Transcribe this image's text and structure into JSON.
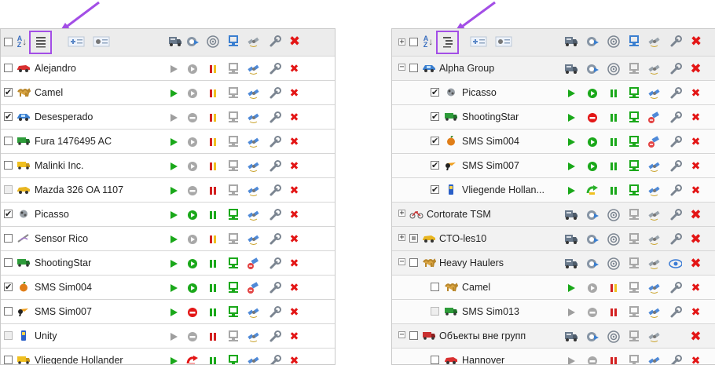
{
  "colors": {
    "arrow": "#a34ee6",
    "delete_red": "#e31616",
    "play_green": "#1aa81a",
    "stop_red": "#e31616",
    "highlight": "#a34ee6"
  },
  "left": {
    "header": {
      "sort_label": "A↓Z",
      "select_all_checked": false
    },
    "rows": [
      {
        "name": "Alejandro",
        "checked": false,
        "disabled": false,
        "icon": "car-red-icon",
        "play": "gray",
        "status": "gray-circle",
        "signal": "red-yellow",
        "active": false
      },
      {
        "name": "Camel",
        "checked": true,
        "disabled": false,
        "icon": "camel-icon",
        "play": "green",
        "status": "gray-circle",
        "signal": "red-yellow",
        "active": false
      },
      {
        "name": "Desesperado",
        "checked": true,
        "disabled": false,
        "icon": "car-blue-icon",
        "play": "gray",
        "status": "gray-dash",
        "signal": "red-yellow",
        "active": false
      },
      {
        "name": "Fura 1476495 AC",
        "checked": false,
        "disabled": false,
        "icon": "truck-green-icon",
        "play": "green",
        "status": "gray-circle",
        "signal": "red-yellow",
        "active": false
      },
      {
        "name": "Malinki Inc.",
        "checked": false,
        "disabled": false,
        "icon": "truck-yellow-icon",
        "play": "green",
        "status": "gray-circle",
        "signal": "red-yellow",
        "active": false
      },
      {
        "name": "Mazda 326 OA 1107",
        "checked": false,
        "disabled": true,
        "icon": "car-yellow-icon",
        "play": "green",
        "status": "gray-dash",
        "signal": "red-red",
        "active": false
      },
      {
        "name": "Picasso",
        "checked": true,
        "disabled": false,
        "icon": "picasso-icon",
        "play": "green",
        "status": "green-circle",
        "signal": "green",
        "active": true
      },
      {
        "name": "Sensor Rico",
        "checked": false,
        "disabled": false,
        "icon": "sensor-icon",
        "play": "green",
        "status": "gray-circle",
        "signal": "red-yellow",
        "active": false
      },
      {
        "name": "ShootingStar",
        "checked": false,
        "disabled": false,
        "icon": "truck-green-icon",
        "play": "green",
        "status": "green-circle",
        "signal": "green",
        "active": true
      },
      {
        "name": "SMS Sim004",
        "checked": true,
        "disabled": false,
        "icon": "apple-icon",
        "play": "green",
        "status": "green-circle",
        "signal": "green",
        "active": true
      },
      {
        "name": "SMS Sim007",
        "checked": false,
        "disabled": false,
        "icon": "toucan-icon",
        "play": "green",
        "status": "red-stop",
        "signal": "green",
        "active": true
      },
      {
        "name": "Unity",
        "checked": false,
        "disabled": true,
        "icon": "phone-icon",
        "play": "gray",
        "status": "gray-dash",
        "signal": "red-red",
        "active": false
      },
      {
        "name": "Vliegende Hollander",
        "checked": false,
        "disabled": false,
        "icon": "truck-yellow-icon",
        "play": "green",
        "status": "red-arrow",
        "signal": "green",
        "active": true
      }
    ]
  },
  "right": {
    "header": {
      "sort_label": "A↓Z"
    },
    "rows": [
      {
        "kind": "group",
        "name": "Alpha Group",
        "expander": "−",
        "checked": false,
        "icon": "car-blue-icon",
        "delete_big": true
      },
      {
        "kind": "child",
        "name": "Picasso",
        "checked": true,
        "icon": "picasso-icon",
        "status": "green-circle",
        "play": "green",
        "signal": "green",
        "active": true
      },
      {
        "kind": "child",
        "name": "ShootingStar",
        "checked": true,
        "icon": "truck-green-icon",
        "status": "red-stop",
        "play": "green",
        "signal": "green",
        "active": true
      },
      {
        "kind": "child",
        "name": "SMS Sim004",
        "checked": true,
        "icon": "apple-icon",
        "status": "green-circle",
        "play": "green",
        "signal": "green",
        "active": true
      },
      {
        "kind": "child",
        "name": "SMS Sim007",
        "checked": true,
        "icon": "toucan-icon",
        "status": "green-circle",
        "play": "green",
        "signal": "green",
        "active": true
      },
      {
        "kind": "child",
        "name": "Vliegende Hollan...",
        "checked": true,
        "icon": "phone-icon",
        "status": "green-arrow",
        "play": "green",
        "signal": "green",
        "active": true
      },
      {
        "kind": "group",
        "name": "Cortorate TSM",
        "expander": "+",
        "checked": null,
        "icon": "bike-icon",
        "delete_big": true
      },
      {
        "kind": "group",
        "name": "CTO-les10",
        "expander": "+",
        "checked": "partial",
        "icon": "car-yellow-icon",
        "delete_big": true
      },
      {
        "kind": "group",
        "name": "Heavy Haulers",
        "expander": "−",
        "checked": false,
        "icon": "camel-icon",
        "delete_big": true,
        "eye": true
      },
      {
        "kind": "child",
        "name": "Camel",
        "checked": false,
        "icon": "camel-icon",
        "status": "gray-circle",
        "play": "green",
        "signal": "red-yellow",
        "active": false
      },
      {
        "kind": "child",
        "name": "SMS Sim013",
        "checked": false,
        "disabled": true,
        "icon": "truck-green-icon",
        "status": "gray-dash",
        "play": "gray",
        "signal": "red-red",
        "active": false
      },
      {
        "kind": "group",
        "name": "Объекты вне групп",
        "expander": "−",
        "checked": false,
        "icon": "truck-red-icon",
        "delete_big": true,
        "no_wrench": true
      },
      {
        "kind": "child",
        "name": "Hannover",
        "checked": false,
        "icon": "car-red-icon",
        "status": "gray-dash",
        "play": "gray",
        "signal": "red-red",
        "active": false
      }
    ]
  }
}
